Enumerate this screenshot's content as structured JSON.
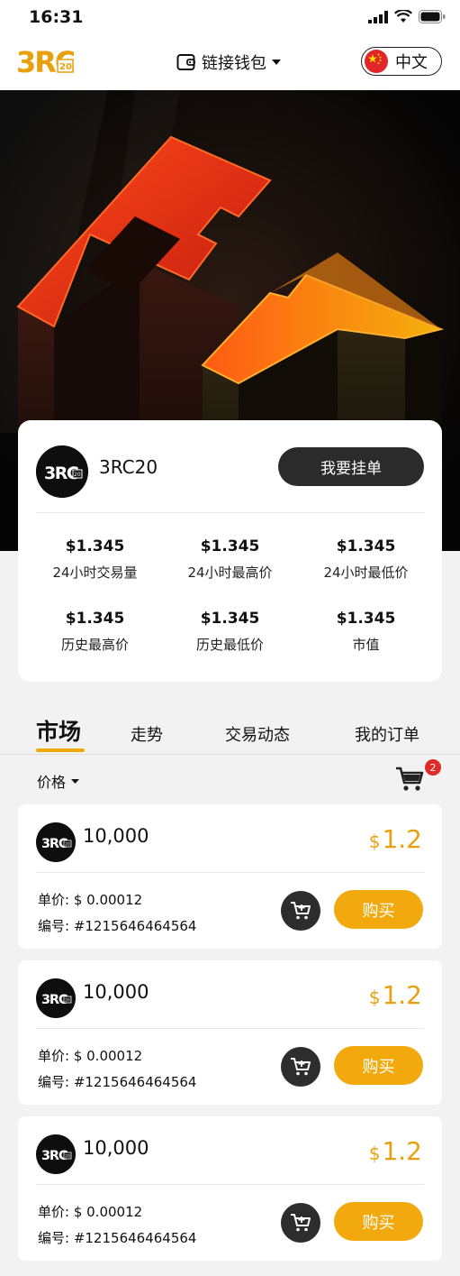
{
  "status_bar": {
    "time": "16:31"
  },
  "header": {
    "wallet_label": "链接钱包",
    "language": "中文"
  },
  "info": {
    "token_name": "3RC20",
    "order_button": "我要挂单",
    "stats": [
      {
        "value": "$1.345",
        "label": "24小时交易量"
      },
      {
        "value": "$1.345",
        "label": "24小时最高价"
      },
      {
        "value": "$1.345",
        "label": "24小时最低价"
      },
      {
        "value": "$1.345",
        "label": "历史最高价"
      },
      {
        "value": "$1.345",
        "label": "历史最低价"
      },
      {
        "value": "$1.345",
        "label": "市值"
      }
    ]
  },
  "tabs": [
    {
      "label": "市场",
      "active": true
    },
    {
      "label": "走势"
    },
    {
      "label": "交易动态"
    },
    {
      "label": "我的订单"
    }
  ],
  "sort": {
    "label": "价格"
  },
  "cart": {
    "count": "2"
  },
  "listings": [
    {
      "amount": "10,000",
      "currency": "$",
      "price": "1.2",
      "unit_price": "单价: $ 0.00012",
      "id": "编号: #1215646464564",
      "buy": "购买"
    },
    {
      "amount": "10,000",
      "currency": "$",
      "price": "1.2",
      "unit_price": "单价: $ 0.00012",
      "id": "编号: #1215646464564",
      "buy": "购买"
    },
    {
      "amount": "10,000",
      "currency": "$",
      "price": "1.2",
      "unit_price": "单价: $ 0.00012",
      "id": "编号: #1215646464564",
      "buy": "购买"
    }
  ],
  "colors": {
    "accent": "#f1a90d",
    "dark": "#2b2b2b",
    "badge": "#e02b2b"
  }
}
